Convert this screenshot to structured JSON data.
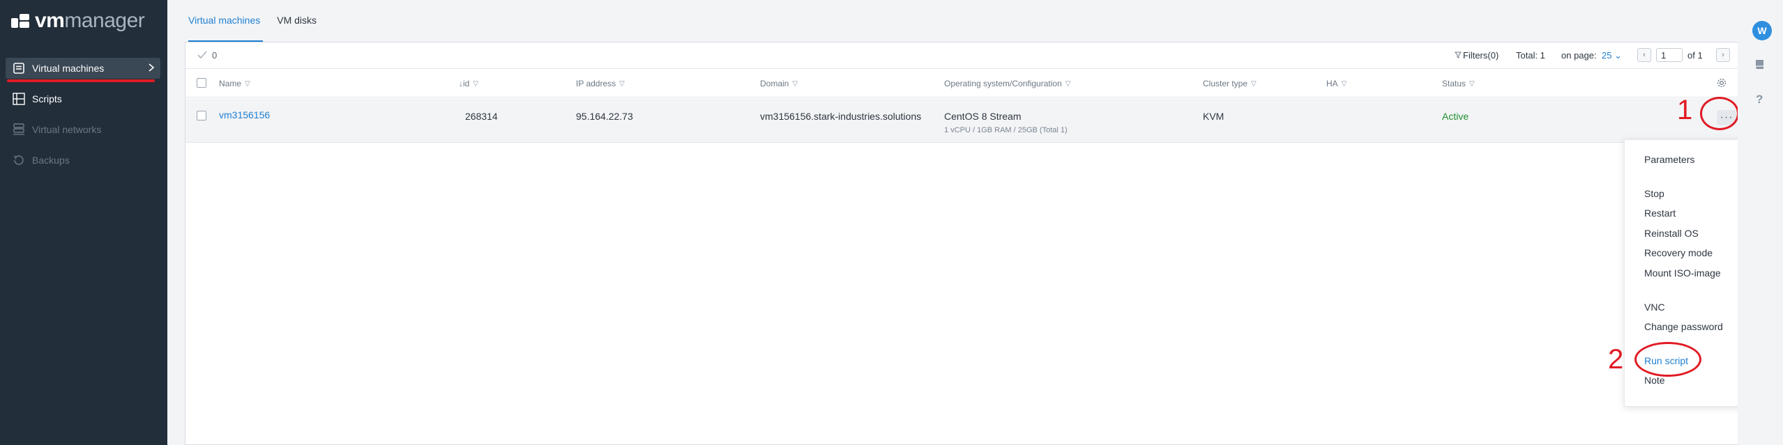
{
  "brand": {
    "name_bold": "vm",
    "name_light": "manager"
  },
  "sidebar": {
    "items": [
      {
        "label": "Virtual machines",
        "icon": "vm-list-icon",
        "state": "active"
      },
      {
        "label": "Scripts",
        "icon": "scripts-icon",
        "state": "normal"
      },
      {
        "label": "Virtual networks",
        "icon": "networks-icon",
        "state": "disabled"
      },
      {
        "label": "Backups",
        "icon": "backups-icon",
        "state": "disabled"
      }
    ]
  },
  "tabs": [
    {
      "label": "Virtual machines",
      "active": true
    },
    {
      "label": "VM disks",
      "active": false
    }
  ],
  "toolbar": {
    "selected_count": "0",
    "filters_label": "Filters(0)",
    "total_label": "Total: 1",
    "on_page_label": "on page:",
    "on_page_value": "25",
    "page_value": "1",
    "of_label": "of 1"
  },
  "table": {
    "columns": [
      "Name",
      "id",
      "IP address",
      "Domain",
      "Operating system/Configuration",
      "Cluster type",
      "HA",
      "Status"
    ],
    "sort_indicator": "↓",
    "rows": [
      {
        "name": "vm3156156",
        "id": "268314",
        "ip": "95.164.22.73",
        "domain": "vm3156156.stark-industries.solutions",
        "os": "CentOS 8 Stream",
        "config": "1 vCPU / 1GB RAM / 25GB (Total 1)",
        "cluster_type": "KVM",
        "ha": "",
        "status": "Active"
      }
    ]
  },
  "menu": {
    "items": [
      "Parameters",
      "Stop",
      "Restart",
      "Reinstall OS",
      "Recovery mode",
      "Mount ISO-image",
      "VNC",
      "Change password",
      "Run script",
      "Note"
    ]
  },
  "annotations": {
    "first": "1",
    "second": "2"
  },
  "user": {
    "avatar_letter": "W"
  },
  "colors": {
    "accent": "#1f7fd1",
    "sidebar": "#222e3a",
    "annotation": "#e01b24",
    "status_active": "#1f8f2f"
  }
}
